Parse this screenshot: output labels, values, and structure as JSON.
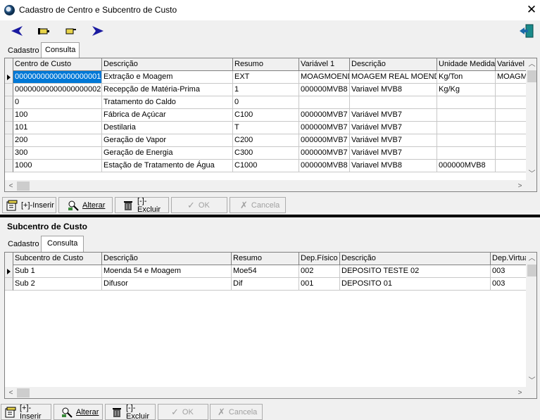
{
  "window": {
    "title": "Cadastro de Centro e Subcentro de Custo"
  },
  "colors": {
    "selection": "#0078d7",
    "nav_arrow": "#1a1aa0",
    "exit_icon": "#1a8a8a"
  },
  "toolbar": {
    "icons": [
      "back-arrow-icon",
      "first-record-icon",
      "pointing-hand-icon",
      "forward-arrow-icon",
      "exit-door-icon"
    ]
  },
  "top": {
    "tabs": [
      "Cadastro",
      "Consulta"
    ],
    "active_tab": "Consulta",
    "columns": [
      "Centro de Custo",
      "Descrição",
      "Resumo",
      "Variável 1",
      "Descrição",
      "Unidade Medida",
      "Variável"
    ],
    "rows": [
      [
        "00000000000000000001",
        "Extração e Moagem",
        "EXT",
        "MOAGMOEND",
        "MOAGEM REAL MOENDA",
        "Kg/Ton",
        "MOAGM"
      ],
      [
        "00000000000000000002",
        "Recepção de Matéria-Prima",
        "1",
        "000000MVB8",
        "Variavel MVB8",
        "Kg/Kg",
        ""
      ],
      [
        "0",
        "Tratamento do Caldo",
        "0",
        "",
        "",
        "",
        ""
      ],
      [
        "100",
        "Fábrica de Açúcar",
        "C100",
        "000000MVB7",
        "Variável MVB7",
        "",
        ""
      ],
      [
        "101",
        "Destilaria",
        "T",
        "000000MVB7",
        "Variável MVB7",
        "",
        ""
      ],
      [
        "200",
        "Geração de Vapor",
        "C200",
        "000000MVB7",
        "Variável MVB7",
        "",
        ""
      ],
      [
        "300",
        "Geração de Energia",
        "C300",
        "000000MVB7",
        "Variável MVB7",
        "",
        ""
      ],
      [
        "1000",
        "Estação de Tratamento de Água",
        "C1000",
        "000000MVB8",
        "Variavel MVB8",
        "000000MVB8",
        ""
      ]
    ]
  },
  "buttons": {
    "insert": "[+]-Inserir",
    "edit": "Alterar",
    "delete": "[-]-Excluir",
    "ok": "OK",
    "cancel": "Cancela"
  },
  "sub": {
    "title": "Subcentro de Custo",
    "tabs": [
      "Cadastro",
      "Consulta"
    ],
    "active_tab": "Consulta",
    "columns": [
      "Subcentro de Custo",
      "Descrição",
      "Resumo",
      "Dep.Físico",
      "Descrição",
      "Dep.Virtual"
    ],
    "rows": [
      [
        "Sub 1",
        "Moenda 54 e Moagem",
        "Moe54",
        "002",
        "DEPOSITO TESTE 02",
        "003"
      ],
      [
        "Sub 2",
        "Difusor",
        "Dif",
        "001",
        "DEPOSITO 01",
        "003"
      ]
    ]
  }
}
